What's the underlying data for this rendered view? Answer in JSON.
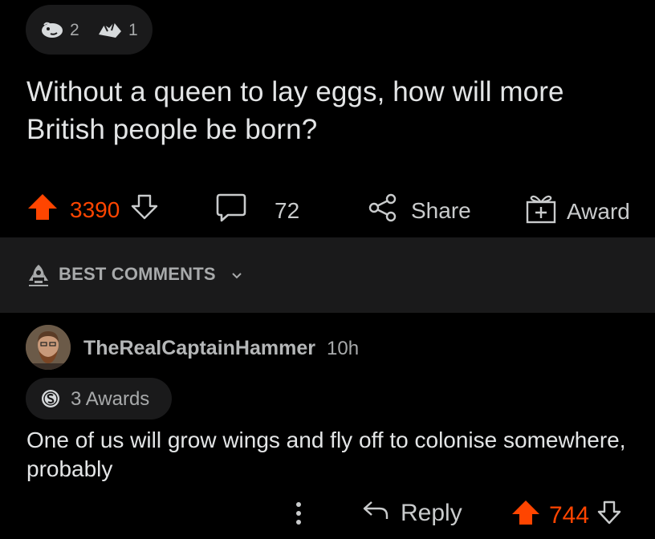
{
  "post": {
    "award_counts": [
      {
        "icon": "award-face-icon",
        "count": "2"
      },
      {
        "icon": "award-hands-icon",
        "count": "1"
      }
    ],
    "title": "Without a queen to lay eggs, how will more British people be born?",
    "vote_count": "3390",
    "comment_count": "72",
    "share_label": "Share",
    "award_label": "Award"
  },
  "sort": {
    "label": "BEST COMMENTS",
    "icon": "rocket-icon"
  },
  "comment": {
    "username": "TheRealCaptainHammer",
    "time": "10h",
    "awards_label": "3 Awards",
    "body": "One of us will grow wings and fly off to colonise somewhere, probably",
    "reply_label": "Reply",
    "vote_count": "744"
  },
  "colors": {
    "background": "#000000",
    "surface": "#1a1a1b",
    "upvote": "#ff4500",
    "text": "#d7dadc"
  }
}
